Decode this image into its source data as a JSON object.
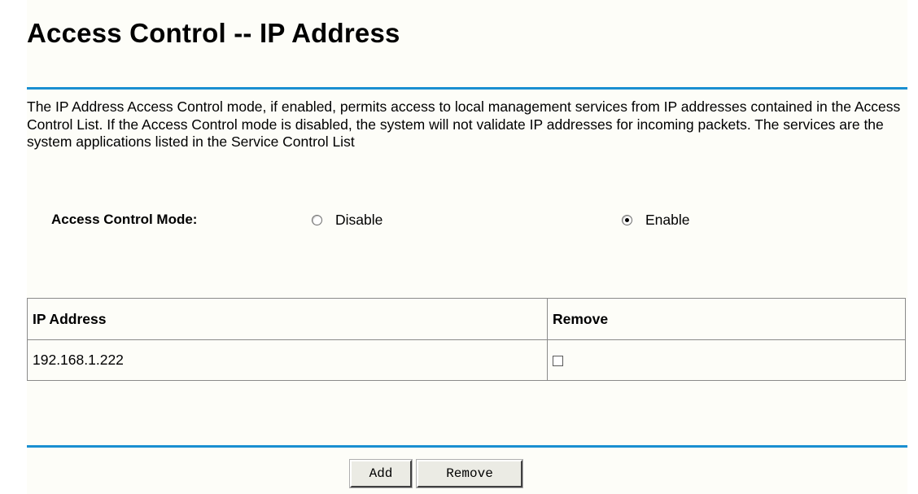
{
  "page": {
    "title": "Access Control -- IP Address",
    "description": "The IP Address Access Control mode, if enabled, permits access to local management services from IP addresses contained in the Access Control List. If the Access Control mode is disabled, the system will not validate IP addresses for incoming packets. The services are the system applications listed in the Service Control List"
  },
  "mode": {
    "label": "Access Control Mode:",
    "options": [
      {
        "label": "Disable",
        "checked": false
      },
      {
        "label": "Enable",
        "checked": true
      }
    ]
  },
  "table": {
    "headers": [
      "IP Address",
      "Remove"
    ],
    "rows": [
      {
        "ip": "192.168.1.222",
        "remove_checked": false
      }
    ]
  },
  "actions": {
    "add_label": "Add",
    "remove_label": "Remove"
  },
  "colors": {
    "accent_rule": "#1a8fd1"
  }
}
